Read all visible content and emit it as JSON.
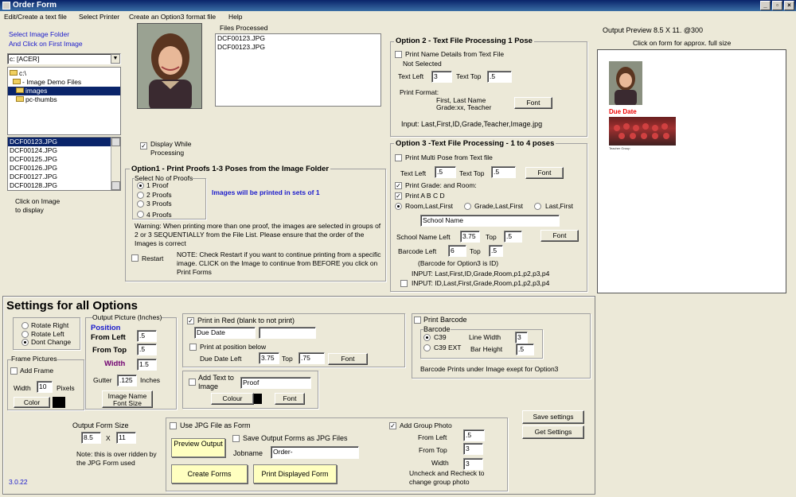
{
  "window": {
    "title": "Order Form"
  },
  "menu": [
    "Edit/Create a text file",
    "Select Printer",
    "Create an Option3 format file",
    "Help"
  ],
  "left": {
    "select_folder": "Select Image Folder",
    "click_first": "And Click on First Image",
    "drive": "c: [ACER]",
    "folders": [
      "c:\\",
      "Image Demo Files",
      "images",
      "pc-thumbs"
    ],
    "files": [
      "DCF00123.JPG",
      "DCF00124.JPG",
      "DCF00125.JPG",
      "DCF00126.JPG",
      "DCF00127.JPG",
      "DCF00128.JPG"
    ],
    "click_image": "Click on Image",
    "to_display": "to display"
  },
  "files_processed": {
    "label": "Files Processed",
    "items": [
      "DCF00123.JPG",
      "DCF00123.JPG"
    ]
  },
  "display_while": "Display While Processing",
  "opt1": {
    "title": "Option1 - Print Proofs 1-3 Poses from the Image Folder",
    "select_label": "Select No of Proofs",
    "proofs": [
      "1 Proof",
      "2 Proofs",
      "3 Proofs",
      "4 Proofs"
    ],
    "sets": "Images will be printed in sets of 1",
    "warning": "Warning: When printing more than one proof, the images are selected in groups of 2 or 3 SEQUENTIALLY from the File List.  Please ensure that the order of the Images is correct",
    "restart": "Restart",
    "note": "NOTE: Check Restart if you want to continue printing from a specific image. CLICK on the Image to continue from BEFORE you click on Print Forms"
  },
  "opt2": {
    "title": "Option 2  - Text File Processing 1 Pose",
    "print_name": "Print Name Details from Text File",
    "not_selected": "Not Selected",
    "text_left": "Text Left",
    "text_left_val": "3",
    "text_top": "Text Top",
    "text_top_val": ".5",
    "format_label": "Print Format:",
    "format_lines": [
      "First, Last Name",
      "Grade:xx, Teacher"
    ],
    "font": "Font",
    "input": "Input:   Last,First,ID,Grade,Teacher,Image.jpg"
  },
  "opt3": {
    "title": "Option 3 -Text File Processing - 1 to 4 poses",
    "multi": "Print Multi Pose from Text file",
    "text_left": "Text Left",
    "text_left_val": ".5",
    "text_top": "Text Top",
    "text_top_val": ".5",
    "font": "Font",
    "grade_room": "Print Grade: and Room:",
    "print_abcd": "Print A  B  C  D",
    "orders": [
      "Room,Last,First",
      "Grade,Last,First",
      "Last,First"
    ],
    "school_name": "School Name",
    "school_left": "School Name Left",
    "school_left_val": "3.75",
    "top": "Top",
    "school_top_val": ".5",
    "barcode_left": "Barcode Left",
    "barcode_left_val": "6",
    "barcode_top": "Top",
    "barcode_top_val": ".5",
    "barcode_note": "(Barcode for Option3 is ID)",
    "input1": "INPUT:  Last,First,ID,Grade,Room,p1,p2,p3,p4",
    "input2": "INPUT:  ID,Last,First,Grade,Room,p1,p2,p3,p4"
  },
  "preview": {
    "title": "Output Preview 8.5 X 11. @300",
    "click": "Click on form for approx. full size",
    "due": "Due Date",
    "caption": "Teacher Group"
  },
  "settings": {
    "title": "Settings for all Options",
    "rotate": [
      "Rotate Right",
      "Rotate Left",
      "Dont Change"
    ],
    "frame_title": "Frame Pictures",
    "add_frame": "Add Frame",
    "width_label": "Width",
    "width_val": "10",
    "pixels": "Pixels",
    "color": "Color",
    "output_pic": "Output Picture (Inches)",
    "position": "Position",
    "from_left": "From Left",
    "from_left_val": ".5",
    "from_top": "From Top",
    "from_top_val": ".5",
    "width": "Width",
    "width_pic_val": "1.5",
    "gutter": "Gutter",
    "gutter_val": ".125",
    "inches": "Inches",
    "image_name_font": "Image Name Font Size",
    "print_red": "Print in Red (blank to not print)",
    "due_date": "Due Date",
    "print_pos": "Print at position below",
    "due_left": "Due Date Left",
    "due_left_val": "3.75",
    "top": "Top",
    "due_top_val": ".75",
    "font": "Font",
    "add_text": "Add Text to Image",
    "proof": "Proof",
    "colour": "Colour",
    "print_barcode": "Print Barcode",
    "barcode": "Barcode",
    "c39": "C39",
    "c39ext": "C39 EXT",
    "line_width": "Line Width",
    "line_width_val": "3",
    "bar_height": "Bar Height",
    "bar_height_val": ".5",
    "barcode_note": "Barcode Prints under Image exept for Option3",
    "output_form_size": "Output Form Size",
    "form_w": "8.5",
    "x": "X",
    "form_h": "11",
    "note": "Note: this is over ridden by the JPG Form used",
    "version": "3.0.22",
    "use_jpg": "Use JPG File as Form",
    "preview_output": "Preview Output",
    "save_jpg": "Save Output  Forms as JPG Files",
    "jobname": "Jobname",
    "jobname_val": "Order-",
    "create": "Create Forms",
    "print_displayed": "Print  Displayed Form",
    "add_group": "Add Group Photo",
    "g_from_left": "From Left",
    "g_from_left_val": ".5",
    "g_from_top": "From Top",
    "g_from_top_val": "3",
    "g_width": "Width",
    "g_width_val": "3",
    "uncheck": "Uncheck and Recheck to change group photo",
    "save_settings": "Save settings",
    "get_settings": "Get Settings"
  }
}
